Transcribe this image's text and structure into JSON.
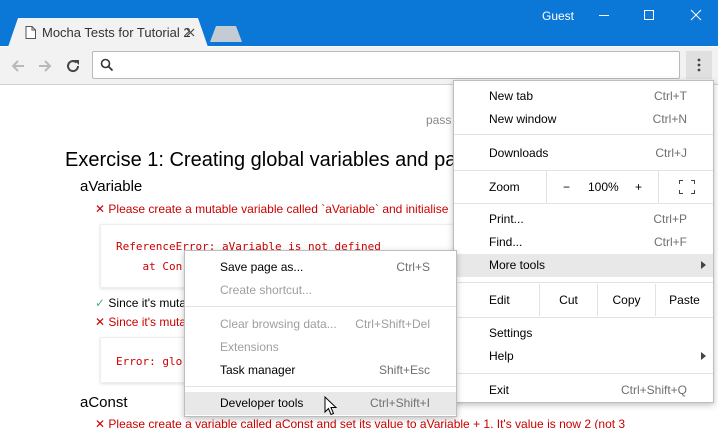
{
  "browser": {
    "tab_title": "Mocha Tests for Tutorial 2",
    "profile_label": "Guest",
    "address_value": ""
  },
  "page": {
    "stats_partial": "pass",
    "exercise_heading": "Exercise 1: Creating global variables and pa",
    "avariable_heading": "aVariable",
    "avariable_error": "Please create a mutable variable called `aVariable` and initialise",
    "code1_line1": "ReferenceError: aVariable is not defined",
    "code1_line2": "    at Con",
    "pass_partial": "Since it's muta",
    "fail_partial": "Since it's muta",
    "code2_line1": "Error: glo",
    "aconst_heading": "aConst",
    "aconst_error": "Please create a variable called aConst and set its value to aVariable + 1. It's value is now 2 (not 3"
  },
  "menu": {
    "new_tab": {
      "label": "New tab",
      "shortcut": "Ctrl+T"
    },
    "new_window": {
      "label": "New window",
      "shortcut": "Ctrl+N"
    },
    "downloads": {
      "label": "Downloads",
      "shortcut": "Ctrl+J"
    },
    "zoom": {
      "label": "Zoom",
      "minus": "−",
      "value": "100%",
      "plus": "+"
    },
    "print": {
      "label": "Print...",
      "shortcut": "Ctrl+P"
    },
    "find": {
      "label": "Find...",
      "shortcut": "Ctrl+F"
    },
    "more_tools": {
      "label": "More tools"
    },
    "edit": {
      "label": "Edit",
      "cut": "Cut",
      "copy": "Copy",
      "paste": "Paste"
    },
    "settings": {
      "label": "Settings"
    },
    "help": {
      "label": "Help"
    },
    "exit": {
      "label": "Exit",
      "shortcut": "Ctrl+Shift+Q"
    }
  },
  "submenu": {
    "save_page": {
      "label": "Save page as...",
      "shortcut": "Ctrl+S"
    },
    "create_shortcut": {
      "label": "Create shortcut..."
    },
    "clear_data": {
      "label": "Clear browsing data...",
      "shortcut": "Ctrl+Shift+Del"
    },
    "extensions": {
      "label": "Extensions"
    },
    "task_manager": {
      "label": "Task manager",
      "shortcut": "Shift+Esc"
    },
    "developer_tools": {
      "label": "Developer tools",
      "shortcut": "Ctrl+Shift+I"
    }
  },
  "icons": {
    "error_mark": "✕",
    "check_mark": "✓"
  },
  "colors": {
    "titlebar": "#0b78d7",
    "error": "#cc0000",
    "pass": "#4caf7a"
  }
}
